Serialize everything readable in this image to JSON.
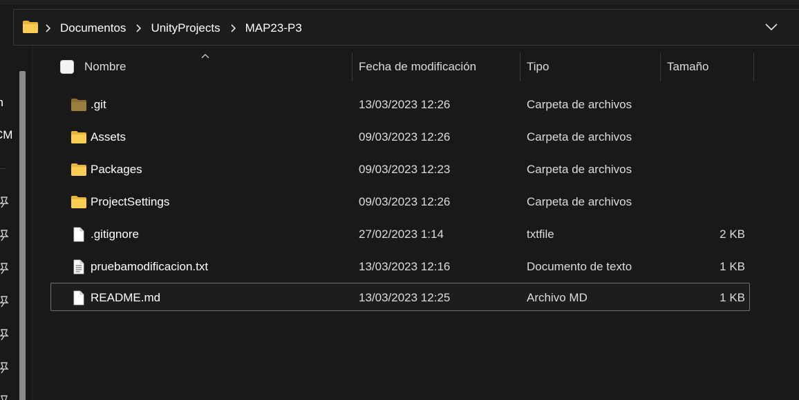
{
  "breadcrumb": {
    "items": [
      "Documentos",
      "UnityProjects",
      "MAP23-P3"
    ]
  },
  "navpane": {
    "item_1": "on",
    "item_2": "CM"
  },
  "columns": {
    "name": "Nombre",
    "date": "Fecha de modificación",
    "type": "Tipo",
    "size": "Tamaño"
  },
  "files": [
    {
      "name": ".git",
      "date": "13/03/2023 12:26",
      "type": "Carpeta de archivos",
      "size": "",
      "icon": "folder-icon-hidden"
    },
    {
      "name": "Assets",
      "date": "09/03/2023 12:26",
      "type": "Carpeta de archivos",
      "size": "",
      "icon": "folder-icon"
    },
    {
      "name": "Packages",
      "date": "09/03/2023 12:23",
      "type": "Carpeta de archivos",
      "size": "",
      "icon": "folder-icon"
    },
    {
      "name": "ProjectSettings",
      "date": "09/03/2023 12:26",
      "type": "Carpeta de archivos",
      "size": "",
      "icon": "folder-icon"
    },
    {
      "name": ".gitignore",
      "date": "27/02/2023 1:14",
      "type": "txtfile",
      "size": "2 KB",
      "icon": "file-icon"
    },
    {
      "name": "pruebamodificacion.txt",
      "date": "13/03/2023 12:16",
      "type": "Documento de texto",
      "size": "1 KB",
      "icon": "text-file-icon"
    },
    {
      "name": "README.md",
      "date": "13/03/2023 12:25",
      "type": "Archivo MD",
      "size": "1 KB",
      "icon": "file-icon",
      "selected": true
    }
  ],
  "colors": {
    "background": "#191919",
    "folder": "#f5c84c",
    "selection_border": "#6f6f6f"
  }
}
